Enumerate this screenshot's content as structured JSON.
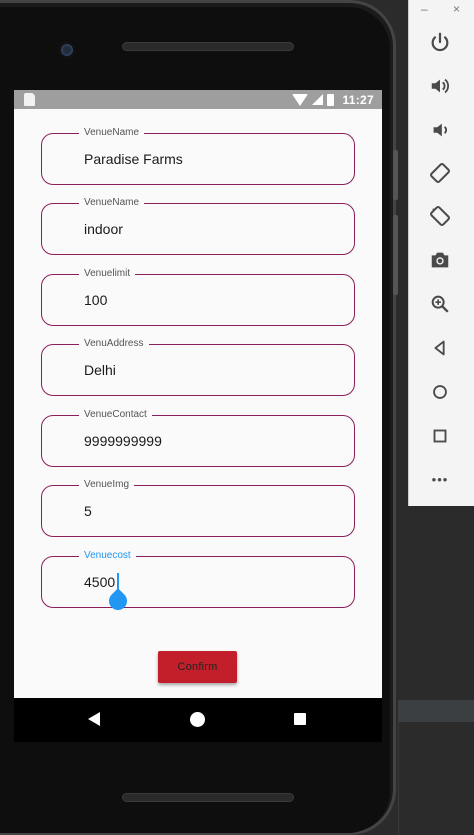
{
  "status_bar": {
    "time": "11:27"
  },
  "form": {
    "fields": [
      {
        "label": "VenueName",
        "value": "Paradise Farms"
      },
      {
        "label": "VenueName",
        "value": "indoor"
      },
      {
        "label": "Venuelimit",
        "value": "100"
      },
      {
        "label": "VenuAddress",
        "value": "Delhi"
      },
      {
        "label": "VenueContact",
        "value": "9999999999"
      },
      {
        "label": "VenueImg",
        "value": "5"
      },
      {
        "label": "Venuecost",
        "value": "4500"
      }
    ],
    "confirm_label": "Confirm"
  },
  "window_controls": {
    "minimize": "–",
    "close": "×"
  },
  "toolbar": {
    "buttons": [
      "power-icon",
      "volume-up-icon",
      "volume-down-icon",
      "rotate-left-icon",
      "rotate-right-icon",
      "camera-icon",
      "zoom-icon",
      "back-icon",
      "home-icon",
      "overview-icon",
      "more-icon"
    ],
    "more_label": "•••"
  },
  "colors": {
    "field_border": "#8b1f5c",
    "focus_accent": "#2196f3",
    "confirm_button": "#c21f2b",
    "status_bar": "#9e9e9e"
  }
}
